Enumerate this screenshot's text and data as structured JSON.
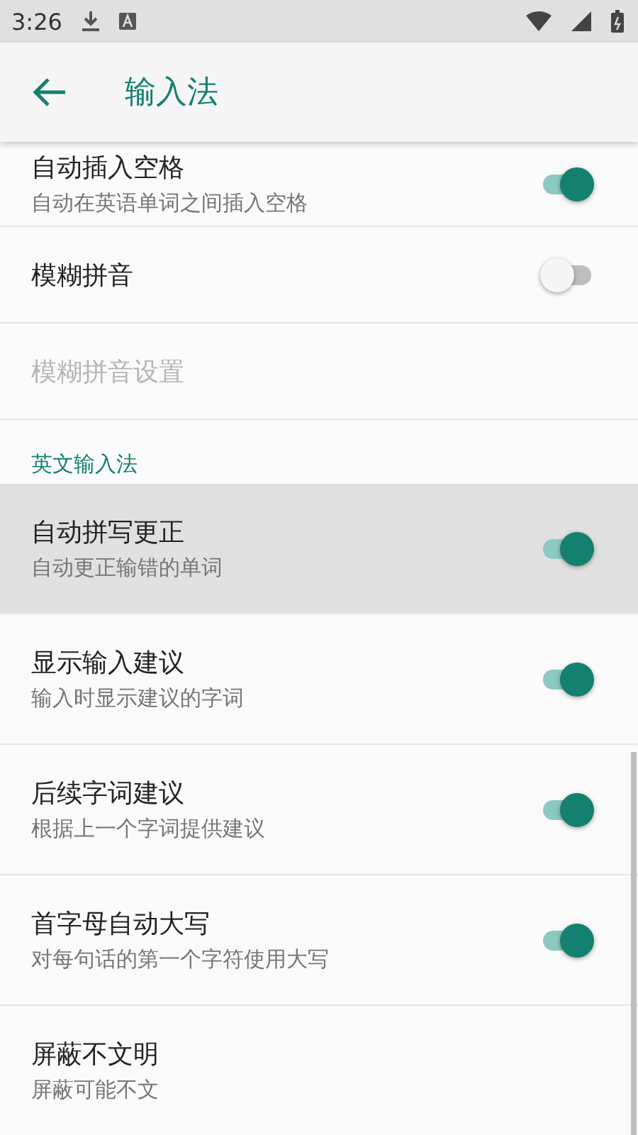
{
  "status_bar": {
    "time": "3:26"
  },
  "app_bar": {
    "title": "输入法"
  },
  "items": [
    {
      "kind": "switch",
      "title": "自动插入空格",
      "summary": "自动在英语单词之间插入空格",
      "on": true,
      "pressed": false
    },
    {
      "kind": "switch",
      "title": "模糊拼音",
      "on": false,
      "pressed": false
    },
    {
      "kind": "plain",
      "title": "模糊拼音设置",
      "disabled": true
    },
    {
      "kind": "category",
      "title": "英文输入法"
    },
    {
      "kind": "switch",
      "title": "自动拼写更正",
      "summary": "自动更正输错的单词",
      "on": true,
      "pressed": true
    },
    {
      "kind": "switch",
      "title": "显示输入建议",
      "summary": "输入时显示建议的字词",
      "on": true,
      "pressed": false
    },
    {
      "kind": "switch",
      "title": "后续字词建议",
      "summary": "根据上一个字词提供建议",
      "on": true,
      "pressed": false
    },
    {
      "kind": "switch",
      "title": "首字母自动大写",
      "summary": "对每句话的第一个字符使用大写",
      "on": true,
      "pressed": false
    },
    {
      "kind": "plain",
      "title": "屏蔽不文明",
      "summary": "屏蔽可能不文",
      "disabled": false
    }
  ]
}
